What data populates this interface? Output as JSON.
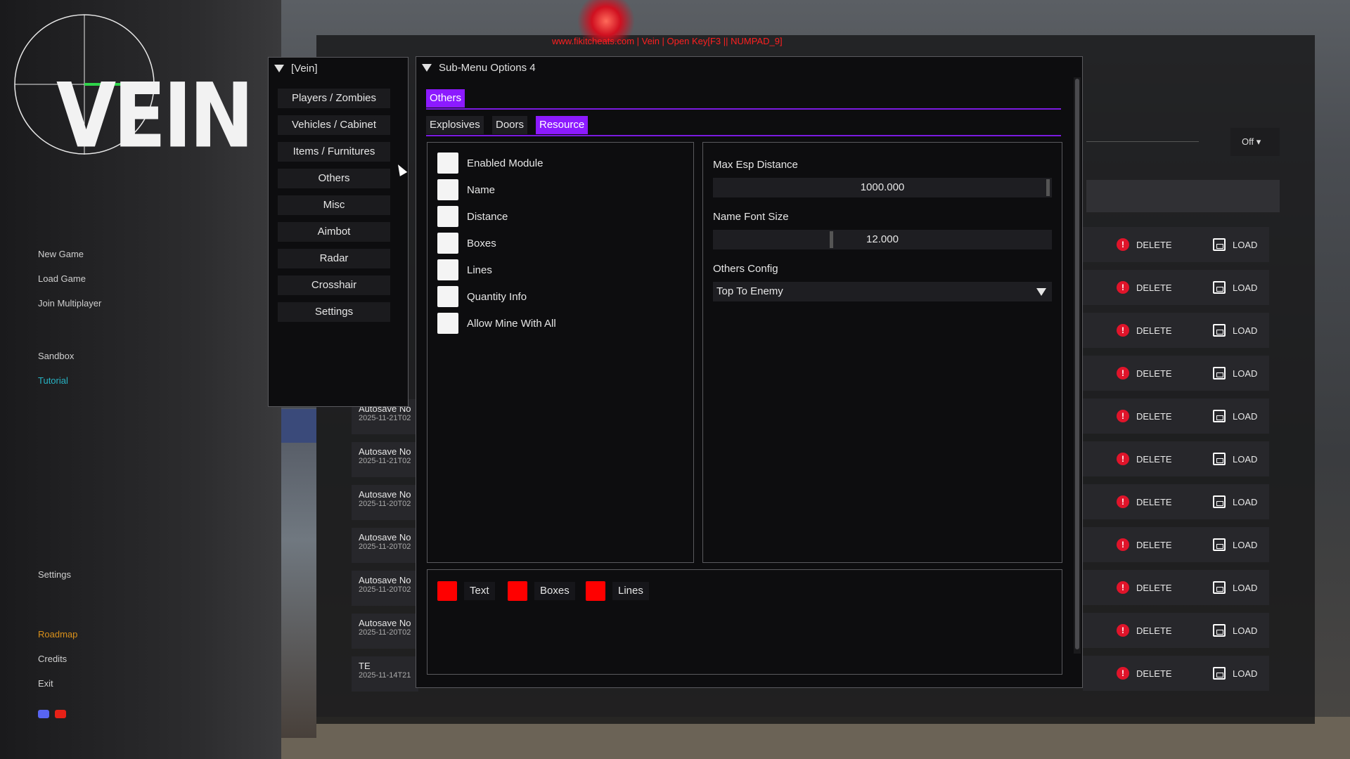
{
  "watermark": "www.fikitcheats.com | Vein | Open Key[F3 || NUMPAD_9]",
  "logo": {
    "text": "VEIN"
  },
  "sidebar": {
    "items": [
      {
        "label": "New Game"
      },
      {
        "label": "Load Game"
      },
      {
        "label": "Join Multiplayer"
      },
      {
        "label": "Sandbox"
      },
      {
        "label": "Tutorial"
      },
      {
        "label": "Settings"
      },
      {
        "label": "Roadmap"
      },
      {
        "label": "Credits"
      },
      {
        "label": "Exit"
      }
    ],
    "social": [
      "discord-icon",
      "youtube-icon"
    ]
  },
  "saves": [
    {
      "name": "Autosave No",
      "date": "2025-11-21T02"
    },
    {
      "name": "Autosave No",
      "date": "2025-11-21T02"
    },
    {
      "name": "Autosave No",
      "date": "2025-11-20T02"
    },
    {
      "name": "Autosave No",
      "date": "2025-11-20T02"
    },
    {
      "name": "Autosave No",
      "date": "2025-11-20T02"
    },
    {
      "name": "Autosave No",
      "date": "2025-11-20T02"
    },
    {
      "name": "TE",
      "date": "2025-11-14T21:"
    }
  ],
  "save_actions": {
    "delete": "DELETE",
    "load": "LOAD"
  },
  "off_dropdown": "Off",
  "cheat_menu": {
    "nav_title": "[Vein]",
    "nav_items": [
      {
        "label": "Players / Zombies"
      },
      {
        "label": "Vehicles / Cabinet"
      },
      {
        "label": "Items / Furnitures"
      },
      {
        "label": "Others"
      },
      {
        "label": "Misc"
      },
      {
        "label": "Aimbot"
      },
      {
        "label": "Radar"
      },
      {
        "label": "Crosshair"
      },
      {
        "label": "Settings"
      }
    ],
    "main_title": "Sub-Menu Options 4",
    "top_tab": "Others",
    "sub_tabs": [
      {
        "label": "Explosives",
        "active": false
      },
      {
        "label": "Doors",
        "active": false
      },
      {
        "label": "Resource",
        "active": true
      }
    ],
    "checkboxes": [
      {
        "label": "Enabled Module",
        "checked": false
      },
      {
        "label": "Name",
        "checked": false
      },
      {
        "label": "Distance",
        "checked": false
      },
      {
        "label": "Boxes",
        "checked": false
      },
      {
        "label": "Lines",
        "checked": false
      },
      {
        "label": "Quantity Info",
        "checked": false
      },
      {
        "label": "Allow Mine With All",
        "checked": false
      }
    ],
    "max_esp_distance": {
      "label": "Max Esp Distance",
      "value": "1000.000",
      "fraction": 1.0
    },
    "name_font_size": {
      "label": "Name Font Size",
      "value": "12.000",
      "fraction": 0.35
    },
    "others_config": {
      "label": "Others Config",
      "value": "Top To Enemy"
    },
    "colors": [
      {
        "label": "Text",
        "color": "#ff0000"
      },
      {
        "label": "Boxes",
        "color": "#ff0000"
      },
      {
        "label": "Lines",
        "color": "#ff0000"
      }
    ],
    "accent_color": "#8c1aff"
  }
}
